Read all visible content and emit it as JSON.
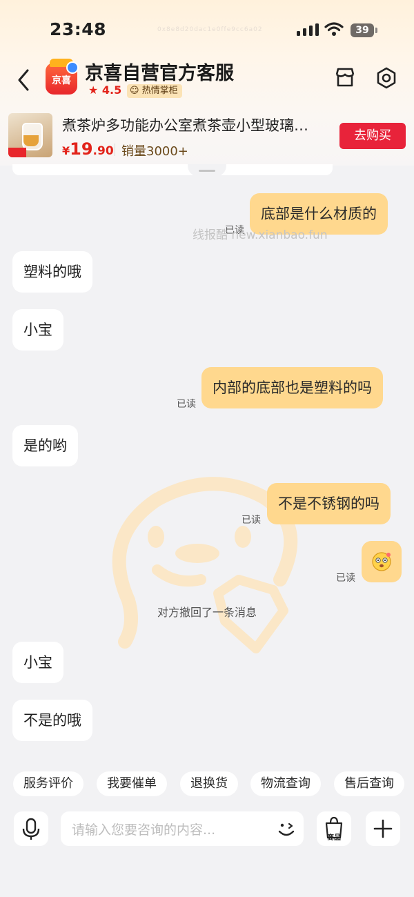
{
  "status_bar": {
    "time": "23:48",
    "battery": "39",
    "overlay_text": "0x8e8d20dac1e0ffe9cc6a02"
  },
  "header": {
    "title": "京喜自营官方客服",
    "rating": "4.5",
    "badge": "热情掌柜",
    "avatar_text": "京喜",
    "icons": [
      "back-icon",
      "store-icon",
      "settings-icon"
    ]
  },
  "product": {
    "title": "煮茶炉多功能办公室煮茶壶小型玻璃…",
    "price_symbol": "¥",
    "price_int": "19",
    "price_dec": ".90",
    "sales": "销量3000+",
    "buy_label": "去购买"
  },
  "watermark_text": "线报酷 new.xianbao.fun",
  "messages": [
    {
      "side": "right",
      "text": "底部是什么材质的",
      "read": "已读"
    },
    {
      "side": "left",
      "text": "塑料的哦"
    },
    {
      "side": "left",
      "text": "小宝"
    },
    {
      "side": "right",
      "text": "内部的底部也是塑料的吗",
      "read": "已读"
    },
    {
      "side": "left",
      "text": "是的哟"
    },
    {
      "side": "right",
      "text": "不是不锈钢的吗",
      "read": "已读"
    },
    {
      "side": "right",
      "emoji": "surprised-emoji",
      "read": "已读"
    },
    {
      "side": "left",
      "text": "小宝"
    },
    {
      "side": "left",
      "text": "不是的哦"
    }
  ],
  "system_notice": "对方撤回了一条消息",
  "quick_actions": [
    "服务评价",
    "我要催单",
    "退换货",
    "物流查询",
    "售后查询"
  ],
  "input": {
    "placeholder": "请输入您要咨询的内容...",
    "goods_label": "商品"
  },
  "colors": {
    "accent": "#e2231a",
    "buy_button": "#e8233a",
    "my_bubble": "#ffd88e",
    "their_bubble": "#ffffff",
    "background": "#f2f2f4"
  }
}
